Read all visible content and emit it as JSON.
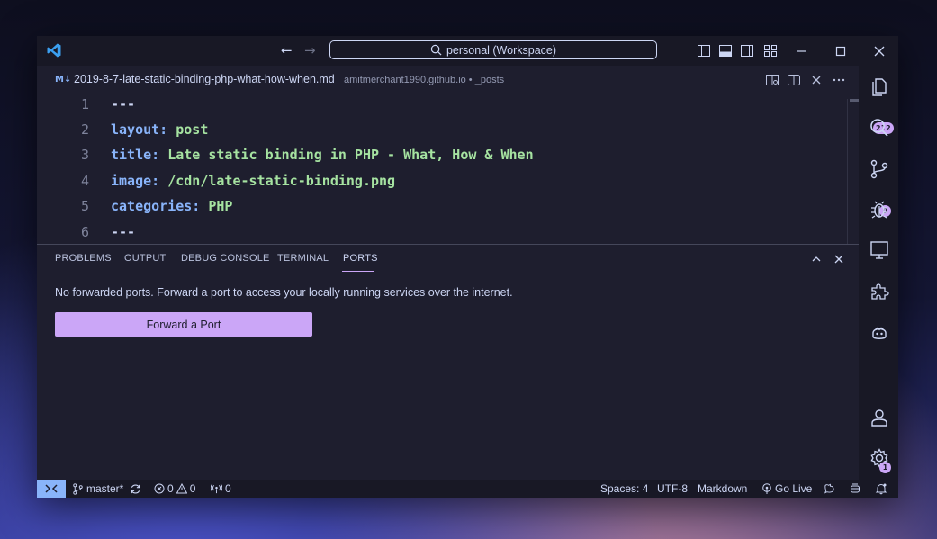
{
  "titlebar": {
    "search_text": "personal (Workspace)",
    "back_icon": "arrow-left-icon",
    "forward_icon": "arrow-right-icon"
  },
  "editor": {
    "tab_icon": "M↓",
    "tab_title": "2019-8-7-late-static-binding-php-what-how-when.md",
    "tab_description": "amitmerchant1990.github.io • _posts",
    "lines": [
      {
        "n": "1",
        "key": "",
        "value": "---"
      },
      {
        "n": "2",
        "key": "layout:",
        "value": " post"
      },
      {
        "n": "3",
        "key": "title:",
        "value": " Late static binding in PHP - What, How & When"
      },
      {
        "n": "4",
        "key": "image:",
        "value": " /cdn/late-static-binding.png"
      },
      {
        "n": "5",
        "key": "categories:",
        "value": " PHP"
      },
      {
        "n": "6",
        "key": "",
        "value": "---"
      }
    ]
  },
  "panel": {
    "tabs": [
      "PROBLEMS",
      "OUTPUT",
      "DEBUG CONSOLE",
      "TERMINAL",
      "PORTS"
    ],
    "active_tab": "PORTS",
    "message": "No forwarded ports. Forward a port to access your locally running services over the internet.",
    "button_label": "Forward a Port"
  },
  "activity_bar": {
    "explorer_badge": "212",
    "source_control_badge": "9",
    "settings_badge": "1"
  },
  "statusbar": {
    "branch": "master*",
    "errors": "0",
    "warnings": "0",
    "ports": "0",
    "spaces": "Spaces: 4",
    "encoding": "UTF-8",
    "language": "Markdown",
    "go_live": "Go Live"
  },
  "colors": {
    "accent": "#cba6f7",
    "keyword": "#89b4fa",
    "string": "#a6e3a1",
    "background": "#1e1e2e"
  }
}
